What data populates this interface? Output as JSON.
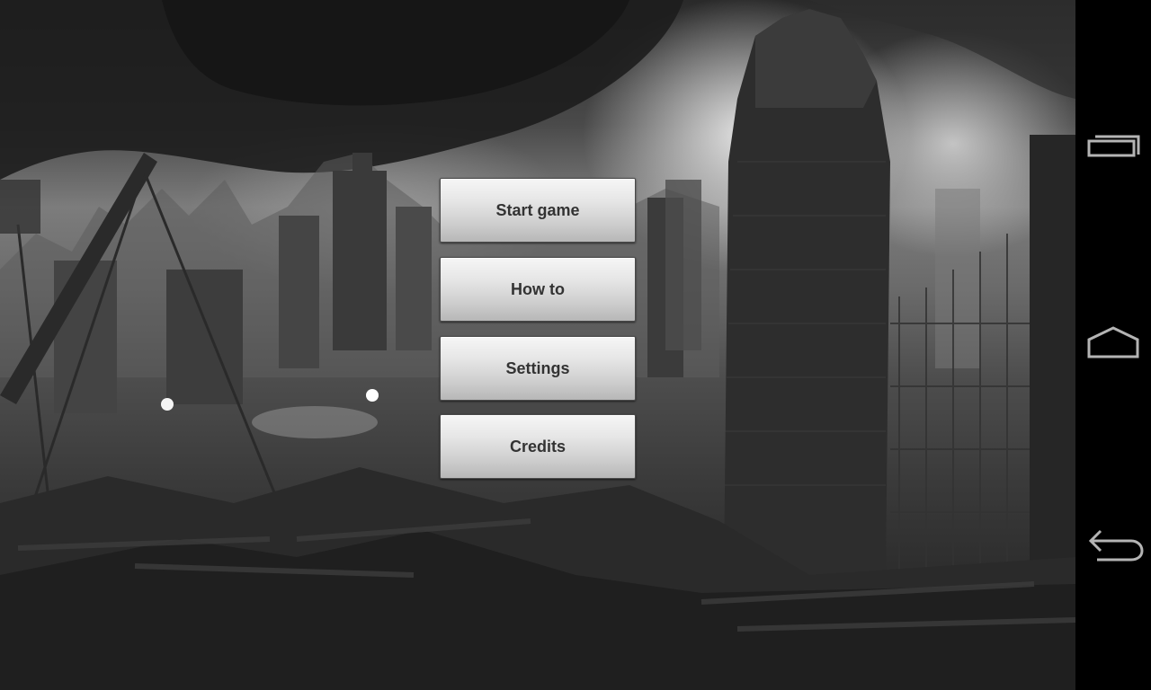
{
  "menu": {
    "items": [
      {
        "id": "start",
        "label": "Start game"
      },
      {
        "id": "howto",
        "label": "How to"
      },
      {
        "id": "settings",
        "label": "Settings"
      },
      {
        "id": "credits",
        "label": "Credits"
      }
    ]
  },
  "navigation_bar": {
    "buttons": [
      {
        "icon": "recent-apps-icon"
      },
      {
        "icon": "home-icon"
      },
      {
        "icon": "back-icon"
      }
    ],
    "icon_color": "#b4b4b4",
    "background": "#000000"
  },
  "background": {
    "description_hidden": true,
    "palette": [
      "#1e1e1e",
      "#4a4a4a",
      "#7c7c7c",
      "#ebebeb"
    ]
  }
}
